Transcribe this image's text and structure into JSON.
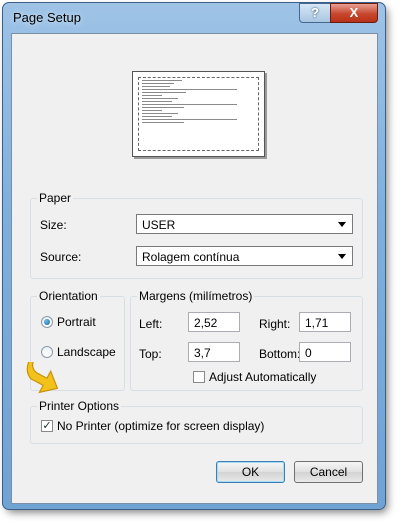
{
  "window": {
    "title": "Page Setup",
    "help_glyph": "?",
    "close_glyph": "X"
  },
  "paper": {
    "legend": "Paper",
    "size_label": "Size:",
    "size_value": "USER",
    "source_label": "Source:",
    "source_value": "Rolagem contínua"
  },
  "orientation": {
    "legend": "Orientation",
    "portrait_label": "Portrait",
    "landscape_label": "Landscape",
    "selected": "Portrait"
  },
  "margins": {
    "legend": "Margens (milímetros)",
    "left_label": "Left:",
    "left_value": "2,52",
    "right_label": "Right:",
    "right_value": "1,71",
    "top_label": "Top:",
    "top_value": "3,7",
    "bottom_label": "Bottom:",
    "bottom_value": "0",
    "adjust_label": "Adjust Automatically",
    "adjust_checked": false
  },
  "printer": {
    "legend": "Printer Options",
    "no_printer_label": "No Printer (optimize for screen display)",
    "no_printer_checked": true
  },
  "buttons": {
    "ok": "OK",
    "cancel": "Cancel"
  },
  "colors": {
    "annotation_arrow": "#f2c21b"
  }
}
